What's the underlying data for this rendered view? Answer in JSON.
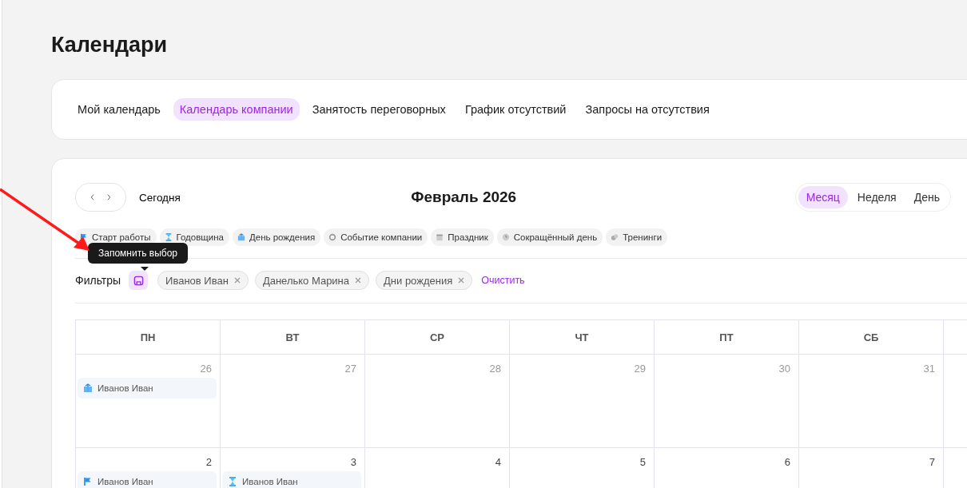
{
  "page": {
    "title": "Календари"
  },
  "tabs": [
    {
      "label": "Мой календарь",
      "selected": false
    },
    {
      "label": "Календарь компании",
      "selected": true
    },
    {
      "label": "Занятость переговорных",
      "selected": false
    },
    {
      "label": "График отсутствий",
      "selected": false
    },
    {
      "label": "Запросы на отсутствия",
      "selected": false
    }
  ],
  "toolbar": {
    "today": "Сегодня",
    "period": "Февраль 2026",
    "views": [
      {
        "label": "Месяц",
        "selected": true
      },
      {
        "label": "Неделя",
        "selected": false
      },
      {
        "label": "День",
        "selected": false
      }
    ]
  },
  "legend": [
    {
      "kind": "flag",
      "label": "Старт работы"
    },
    {
      "kind": "hourglass",
      "label": "Годовщина"
    },
    {
      "kind": "gift",
      "label": "День рождения"
    },
    {
      "kind": "ring",
      "label": "Событие компании"
    },
    {
      "kind": "calendar",
      "label": "Праздник"
    },
    {
      "kind": "clock",
      "label": "Сокращённый день"
    },
    {
      "kind": "chat",
      "label": "Тренинги"
    }
  ],
  "filters": {
    "label": "Фильтры",
    "tooltip": "Запомнить выбор",
    "chips": [
      "Иванов Иван",
      "Данелько Марина",
      "Дни рождения"
    ],
    "clear": "Очистить"
  },
  "calendar": {
    "weekdays": [
      "ПН",
      "ВТ",
      "СР",
      "ЧТ",
      "ПТ",
      "СБ"
    ],
    "weeks": [
      [
        {
          "day": "26",
          "other_month": true,
          "events": [
            {
              "kind": "gift",
              "name": "Иванов Иван"
            }
          ]
        },
        {
          "day": "27",
          "other_month": true
        },
        {
          "day": "28",
          "other_month": true
        },
        {
          "day": "29",
          "other_month": true
        },
        {
          "day": "30",
          "other_month": true
        },
        {
          "day": "31",
          "other_month": true
        }
      ],
      [
        {
          "day": "2",
          "other_month": false,
          "events": [
            {
              "kind": "flag",
              "name": "Иванов Иван"
            }
          ]
        },
        {
          "day": "3",
          "other_month": false,
          "events": [
            {
              "kind": "hourglass",
              "name": "Иванов Иван"
            }
          ]
        },
        {
          "day": "4",
          "other_month": false
        },
        {
          "day": "5",
          "other_month": false
        },
        {
          "day": "6",
          "other_month": false
        },
        {
          "day": "7",
          "other_month": false
        }
      ]
    ]
  }
}
